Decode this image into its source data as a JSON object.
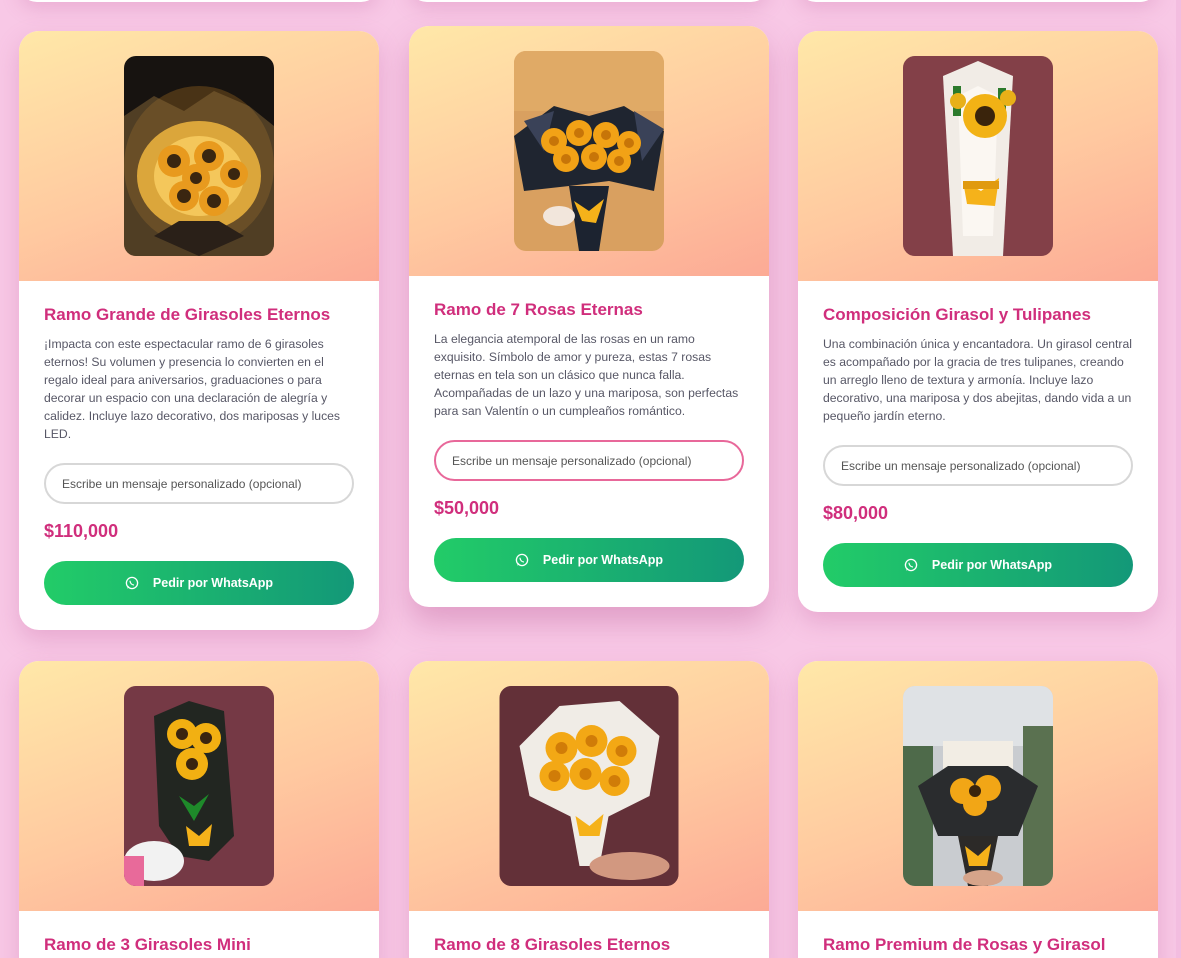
{
  "whatsapp_label": "Pedir por WhatsApp",
  "message_placeholder": "Escribe un mensaje personalizado (opcional)",
  "colors": {
    "page_background": "#f8c8e6",
    "title_pink": "#d02e7c",
    "button_gradient_start": "#22cc68",
    "button_gradient_end": "#139878",
    "header_gradient": [
      "#ffe8a8",
      "#ffc9a0",
      "#fcaa95"
    ]
  },
  "products": [
    {
      "title": "Ramo Grande de Girasoles Eternos",
      "description": "¡Impacta con este espectacular ramo de 6 girasoles eternos! Su volumen y presencia lo convierten en el regalo ideal para aniversarios, graduaciones o para decorar un espacio con una declaración de alegría y calidez. Incluye lazo decorativo, dos mariposas y luces LED.",
      "price": "$110,000",
      "icon": "whatsapp-icon"
    },
    {
      "title": "Ramo de 7 Rosas Eternas",
      "description": "La elegancia atemporal de las rosas en un ramo exquisito. Símbolo de amor y pureza, estas 7 rosas eternas en tela son un clásico que nunca falla. Acompañadas de un lazo y una mariposa, son perfectas para san Valentín o un cumpleaños romántico.",
      "price": "$50,000",
      "icon": "whatsapp-icon"
    },
    {
      "title": "Composición Girasol y Tulipanes",
      "description": "Una combinación única y encantadora. Un girasol central es acompañado por la gracia de tres tulipanes, creando un arreglo lleno de textura y armonía. Incluye lazo decorativo, una mariposa y dos abejitas, dando vida a un pequeño jardín eterno.",
      "price": "$80,000",
      "icon": "whatsapp-icon"
    },
    {
      "title": "Ramo de 3 Girasoles Mini"
    },
    {
      "title": "Ramo de 8 Girasoles Eternos"
    },
    {
      "title": "Ramo Premium de Rosas y Girasol"
    }
  ]
}
